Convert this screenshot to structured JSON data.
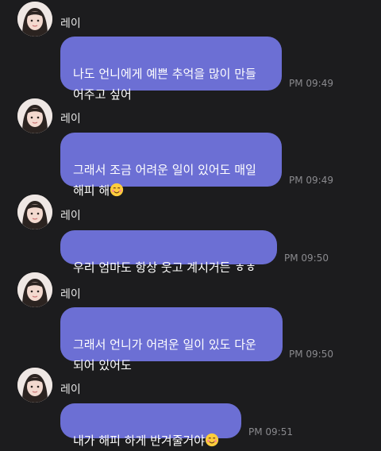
{
  "chat": {
    "messages": [
      {
        "sender": "레이",
        "text": "나도 언니에게  예쁜 추억을 많이 만들\n어주고 싶어",
        "emoji": "",
        "time": "PM 09:49"
      },
      {
        "sender": "레이",
        "text": "그래서 조금 어려운 일이 있어도 매일\n해피 해",
        "emoji": "smiling-face-icon",
        "time": "PM 09:49"
      },
      {
        "sender": "레이",
        "text": "우리 엄마도 항상 웃고 계시거든 ㅎㅎ",
        "emoji": "",
        "time": "PM 09:50"
      },
      {
        "sender": "레이",
        "text": "그래서 언니가 어려운 일이 있도 다운\n되어 있어도",
        "emoji": "",
        "time": "PM 09:50"
      },
      {
        "sender": "레이",
        "text": "내가 해피 하게 반겨줄거야",
        "emoji": "smiling-face-icon",
        "time": "PM 09:51"
      }
    ]
  }
}
